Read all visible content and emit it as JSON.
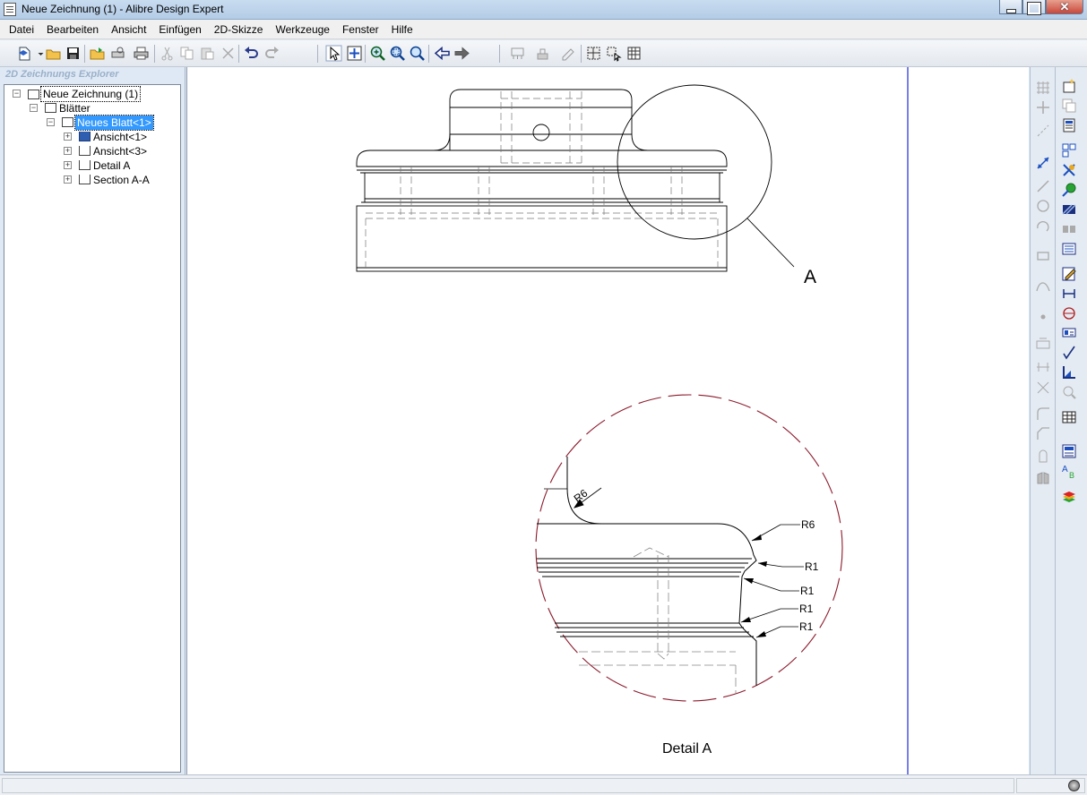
{
  "window": {
    "title": "Neue Zeichnung (1) - Alibre Design Expert"
  },
  "menu": [
    "Datei",
    "Bearbeiten",
    "Ansicht",
    "Einfügen",
    "2D-Skizze",
    "Werkzeuge",
    "Fenster",
    "Hilfe"
  ],
  "toolbar": {
    "icons": [
      "new-icon",
      "open-icon",
      "save-icon",
      "open-folder-icon",
      "print-preview-icon",
      "print-icon",
      "cut-icon",
      "copy-icon",
      "paste-icon",
      "delete-icon",
      "undo-icon",
      "redo-icon",
      "select-icon",
      "pan-icon",
      "zoom-in-icon",
      "zoom-window-icon",
      "zoom-all-icon",
      "back-icon",
      "forward-icon"
    ]
  },
  "explorer": {
    "title": "2D Zeichnungs Explorer",
    "tree": [
      {
        "label": "Neue Zeichnung (1)",
        "level": 0,
        "toggle": "−",
        "icon": "drawing-icon"
      },
      {
        "label": "Blätter",
        "level": 1,
        "toggle": "−",
        "icon": "sheets-icon"
      },
      {
        "label": "Neues Blatt<1>",
        "level": 2,
        "toggle": "−",
        "icon": "sheet-icon",
        "selected": true
      },
      {
        "label": "Ansicht<1>",
        "level": 3,
        "toggle": "+",
        "icon": "view-icon"
      },
      {
        "label": "Ansicht<3>",
        "level": 3,
        "toggle": "+",
        "icon": "view-icon"
      },
      {
        "label": "Detail A",
        "level": 3,
        "toggle": "+",
        "icon": "view-icon"
      },
      {
        "label": "Section A-A",
        "level": 3,
        "toggle": "+",
        "icon": "view-icon"
      }
    ]
  },
  "drawing": {
    "detail_callout": "A",
    "detail_caption": "Detail A",
    "dimensions": [
      "R6",
      "R6",
      "R1",
      "R1",
      "R1",
      "R1"
    ],
    "line_color": "#000000",
    "detail_circle_color": "#8b1a2b",
    "sheet_border_color": "#1a2bd6"
  },
  "colors": {
    "window_bg": "#dfe9f5",
    "selection": "#3399ff"
  }
}
